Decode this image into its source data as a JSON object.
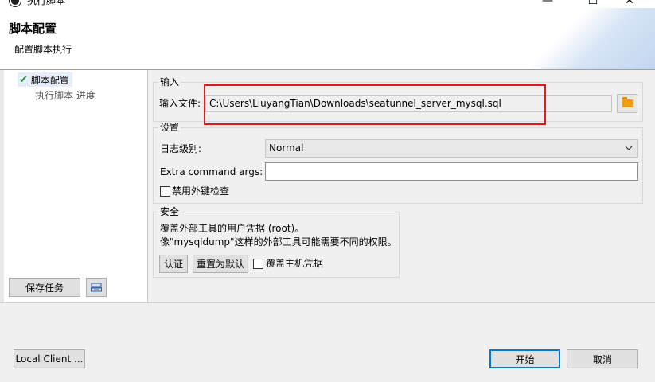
{
  "window": {
    "title": "执行脚本",
    "minimize": "—",
    "maximize": "☐",
    "close": "✕"
  },
  "header": {
    "title": "脚本配置",
    "subtitle": "配置脚本执行"
  },
  "nav": {
    "items": [
      {
        "label": "脚本配置",
        "selected": true
      },
      {
        "label": "执行脚本 进度",
        "selected": false
      }
    ]
  },
  "left_buttons": {
    "save_task": "保存任务",
    "save_icon": "save-task-icon"
  },
  "input_group": {
    "title": "输入",
    "file_label": "输入文件:",
    "file_value": "C:\\Users\\LiuyangTian\\Downloads\\seatunnel_server_mysql.sql",
    "browse_icon": "folder-icon"
  },
  "settings_group": {
    "title": "设置",
    "log_level_label": "日志级别:",
    "log_level_value": "Normal",
    "extra_args_label": "Extra command args:",
    "extra_args_value": "",
    "disable_fk_label": "禁用外键检查",
    "disable_fk_checked": false
  },
  "security_group": {
    "title": "安全",
    "line1": "覆盖外部工具的用户凭据 (root)。",
    "line2": "像\"mysqldump\"这样的外部工具可能需要不同的权限。",
    "auth_button": "认证",
    "reset_button": "重置为默认",
    "override_host_label": "覆盖主机凭据",
    "override_host_checked": false
  },
  "footer": {
    "local_client": "Local Client ...",
    "start": "开始",
    "cancel": "取消"
  },
  "colors": {
    "highlight": "#e21a1a",
    "folder": "#f39c12",
    "default_button_border": "#0078d7",
    "check": "#2e8b3a"
  }
}
